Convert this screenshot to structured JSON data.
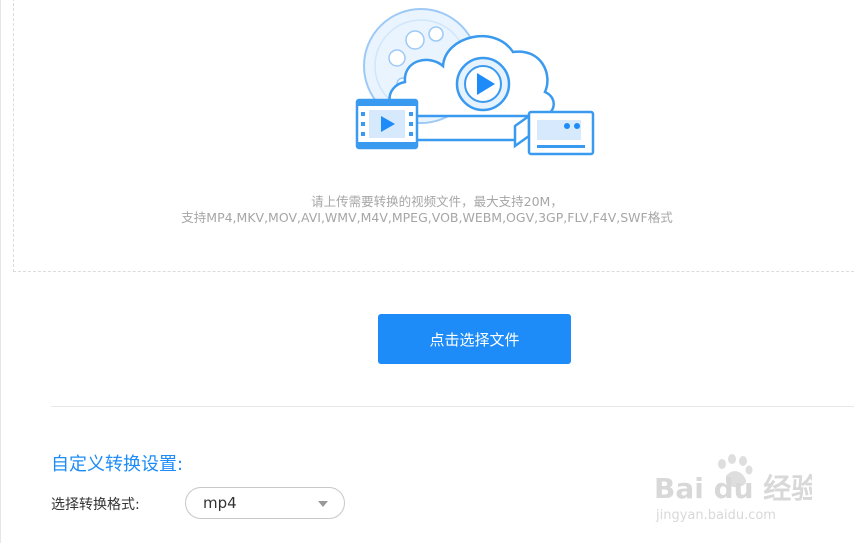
{
  "upload": {
    "hint_line1": "请上传需要转换的视频文件，最大支持20M，",
    "hint_line2": "支持MP4,MKV,MOV,AVI,WMV,M4V,MPEG,VOB,WEBM,OGV,3GP,FLV,F4V,SWF格式",
    "button_label": "点击选择文件"
  },
  "settings": {
    "title": "自定义转换设置:",
    "format_label": "选择转换格式:",
    "format_value": "mp4"
  },
  "watermark": {
    "brand": "Bai du 经验",
    "url": "jingyan.baidu.com"
  },
  "colors": {
    "accent": "#1d8cf8",
    "illustration": "#3a9af0"
  }
}
